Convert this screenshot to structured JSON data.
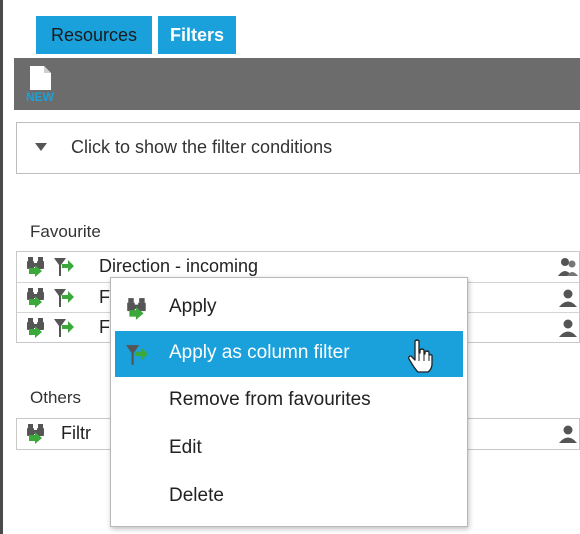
{
  "tabs": [
    {
      "label": "Resources"
    },
    {
      "label": "Filters"
    }
  ],
  "toolbar": {
    "new_label": "NEW"
  },
  "conditions": {
    "label": "Click to show the filter conditions"
  },
  "favourite": {
    "label": "Favourite",
    "rows": [
      {
        "text": "Direction - incoming"
      },
      {
        "text": "F"
      },
      {
        "text": "F"
      }
    ]
  },
  "others": {
    "label": "Others",
    "rows": [
      {
        "text": "Filtr"
      }
    ]
  },
  "context_menu": {
    "items": [
      {
        "label": "Apply"
      },
      {
        "label": "Apply as column filter"
      },
      {
        "label": "Remove from favourites"
      },
      {
        "label": "Edit"
      },
      {
        "label": "Delete"
      }
    ]
  },
  "colors": {
    "accent": "#1aa0db",
    "toolbar": "#6c6c6c",
    "icon_green": "#3aa83a"
  }
}
